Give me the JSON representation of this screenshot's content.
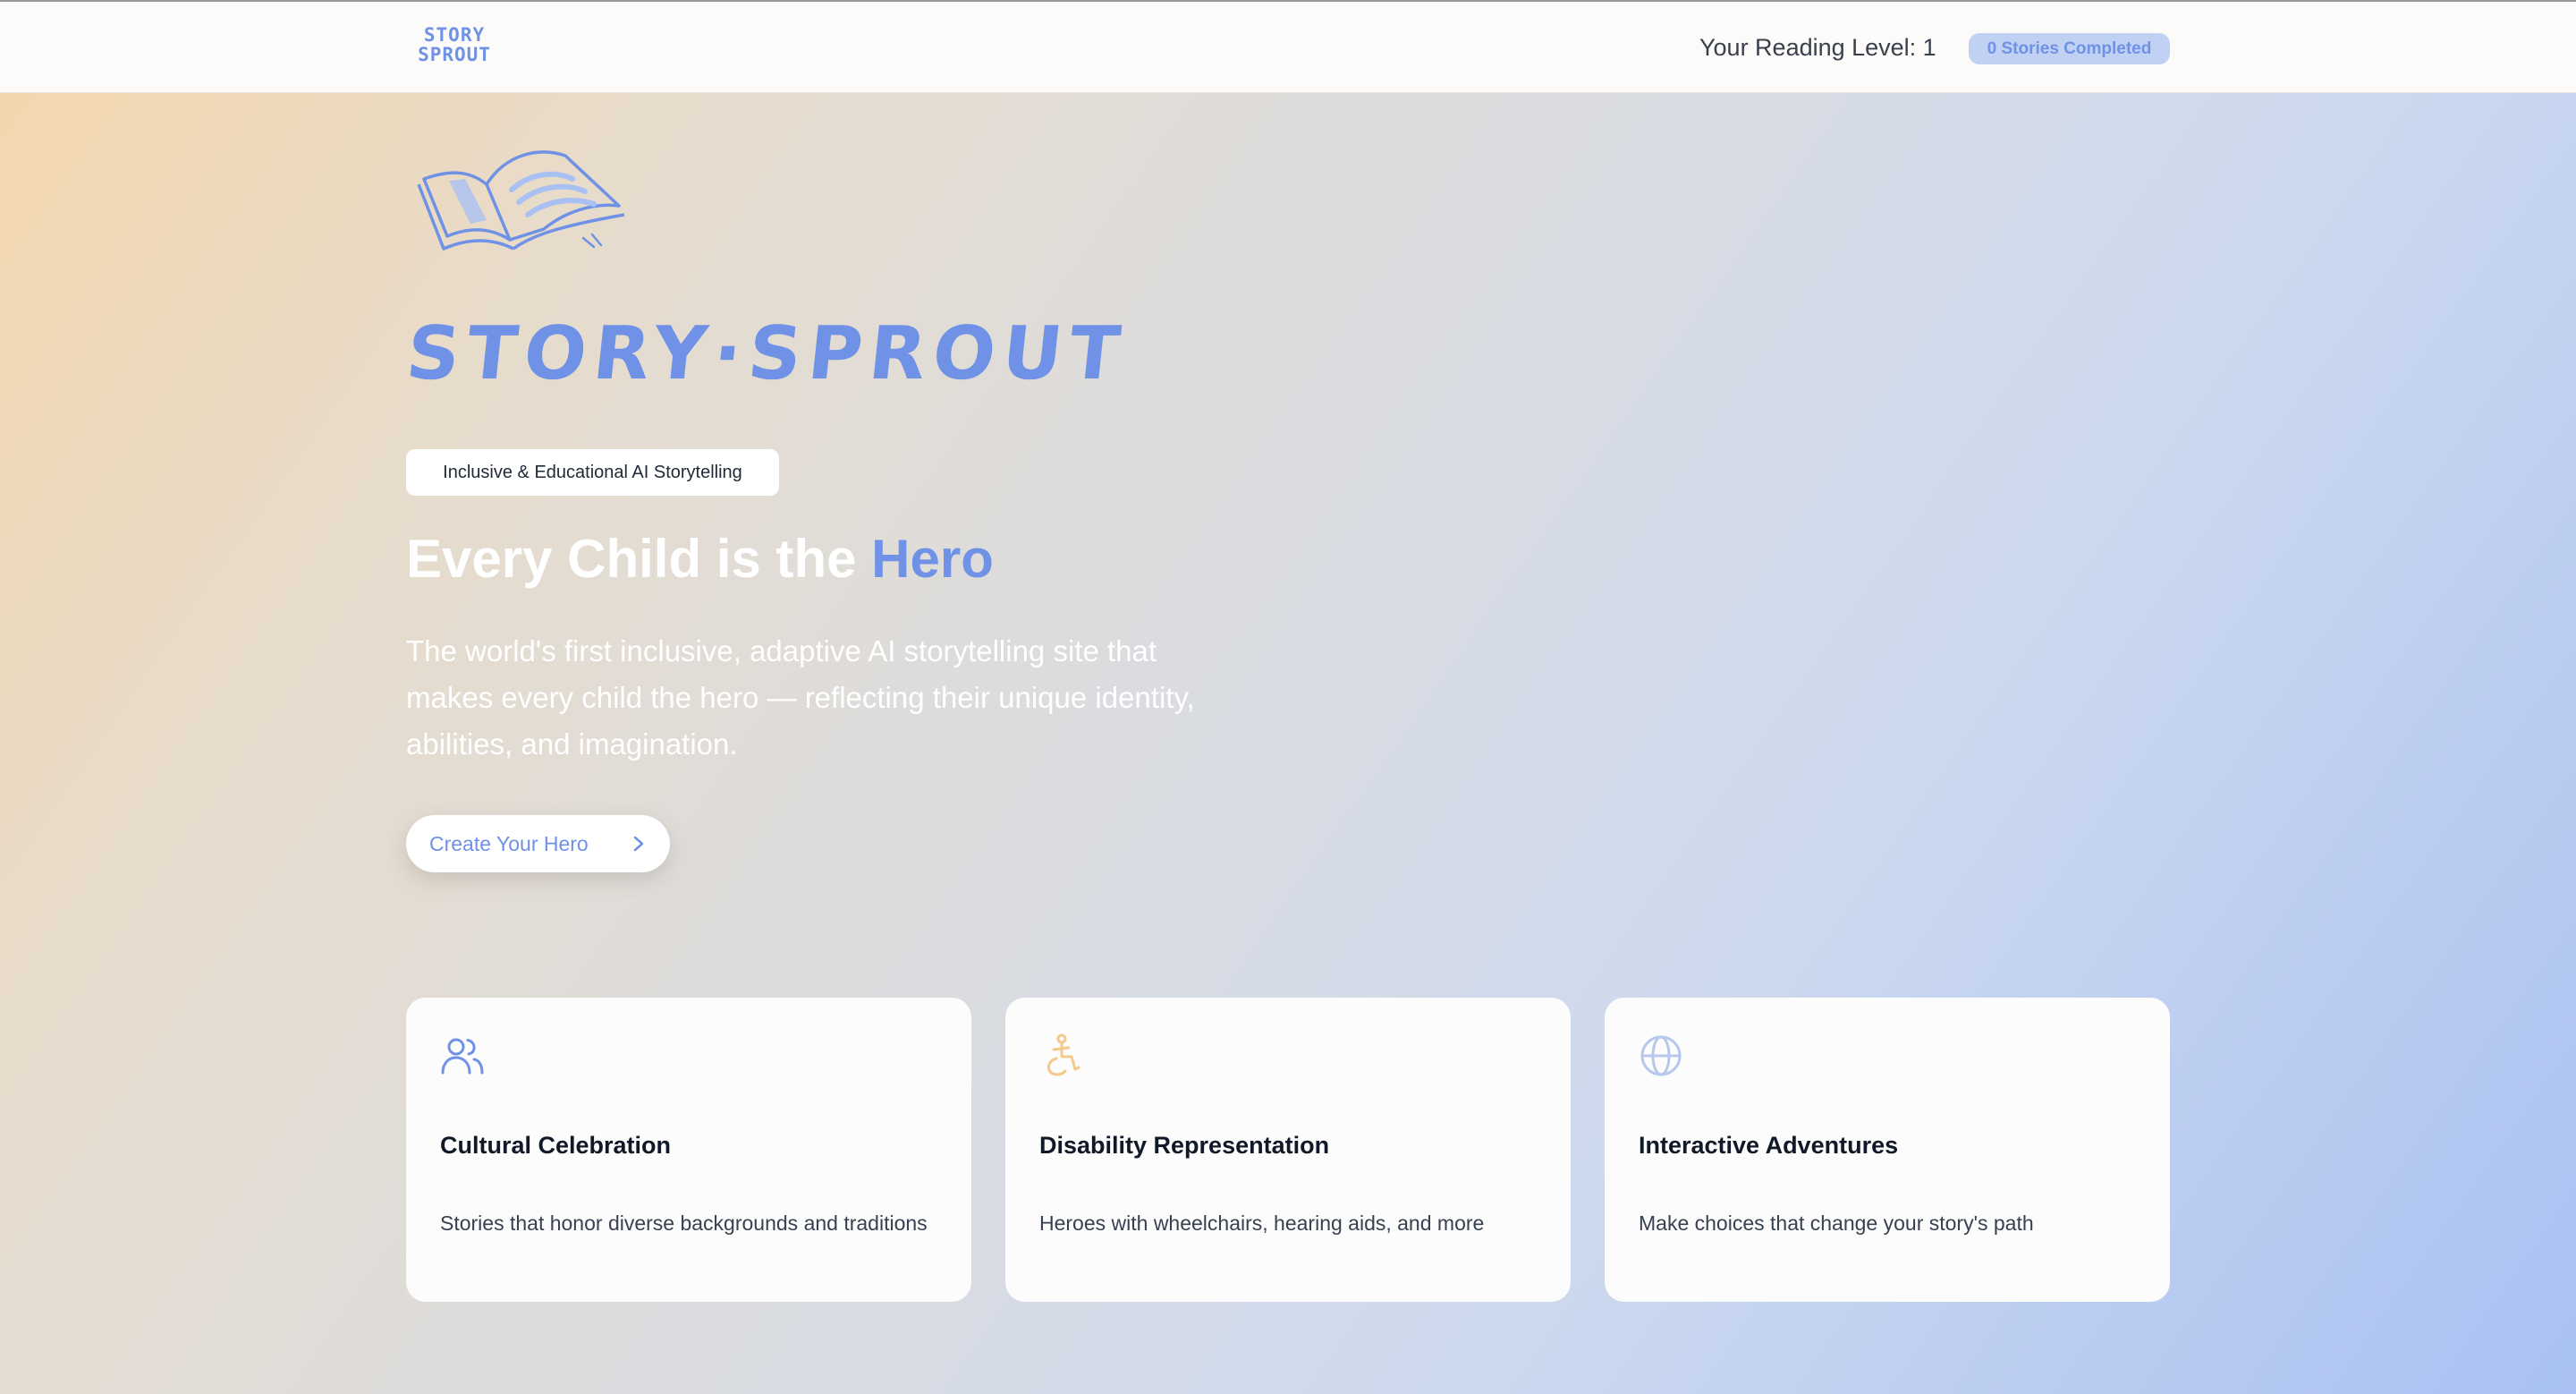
{
  "nav": {
    "logo_line1": "STORY",
    "logo_line2": "SPROUT",
    "reading_level": "Your Reading Level: 1",
    "stories_badge": "0 Stories Completed"
  },
  "hero": {
    "wordmark": "STORY·SPROUT",
    "tagline": "Inclusive & Educational AI Storytelling",
    "headline_prefix": "Every Child is the ",
    "headline_accent": "Hero",
    "subhead": "The world's first inclusive, adaptive AI storytelling site that makes every child the hero — reflecting their unique identity, abilities, and imagination.",
    "cta_label": "Create Your Hero"
  },
  "features": [
    {
      "icon": "users-icon",
      "title": "Cultural Celebration",
      "desc": "Stories that honor diverse backgrounds and traditions"
    },
    {
      "icon": "accessibility-icon",
      "title": "Disability Representation",
      "desc": "Heroes with wheelchairs, hearing aids, and more"
    },
    {
      "icon": "globe-icon",
      "title": "Interactive Adventures",
      "desc": "Make choices that change your story's path"
    }
  ],
  "colors": {
    "brand_blue": "#6f92e6",
    "accent_orange": "#f3c98c",
    "globe_blue": "#b7c8ec",
    "badge_bg": "#c1d1f3"
  }
}
